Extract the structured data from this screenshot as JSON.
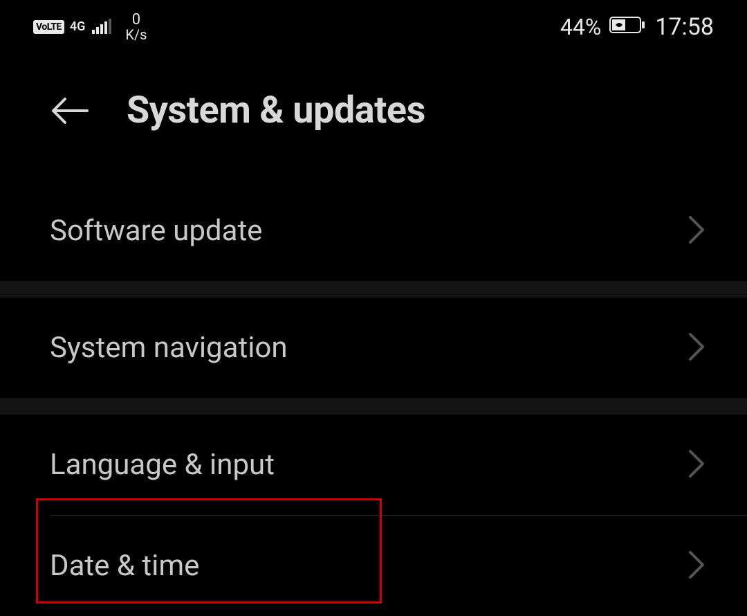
{
  "status": {
    "volte": "VoLTE",
    "network": "4G",
    "speed_value": "0",
    "speed_unit": "K/s",
    "battery_pct": "44%",
    "time": "17:58"
  },
  "header": {
    "title": "System & updates"
  },
  "items": {
    "software_update": "Software update",
    "system_navigation": "System navigation",
    "language_input": "Language & input",
    "date_time": "Date & time"
  },
  "highlight": {
    "target": "date_time"
  }
}
